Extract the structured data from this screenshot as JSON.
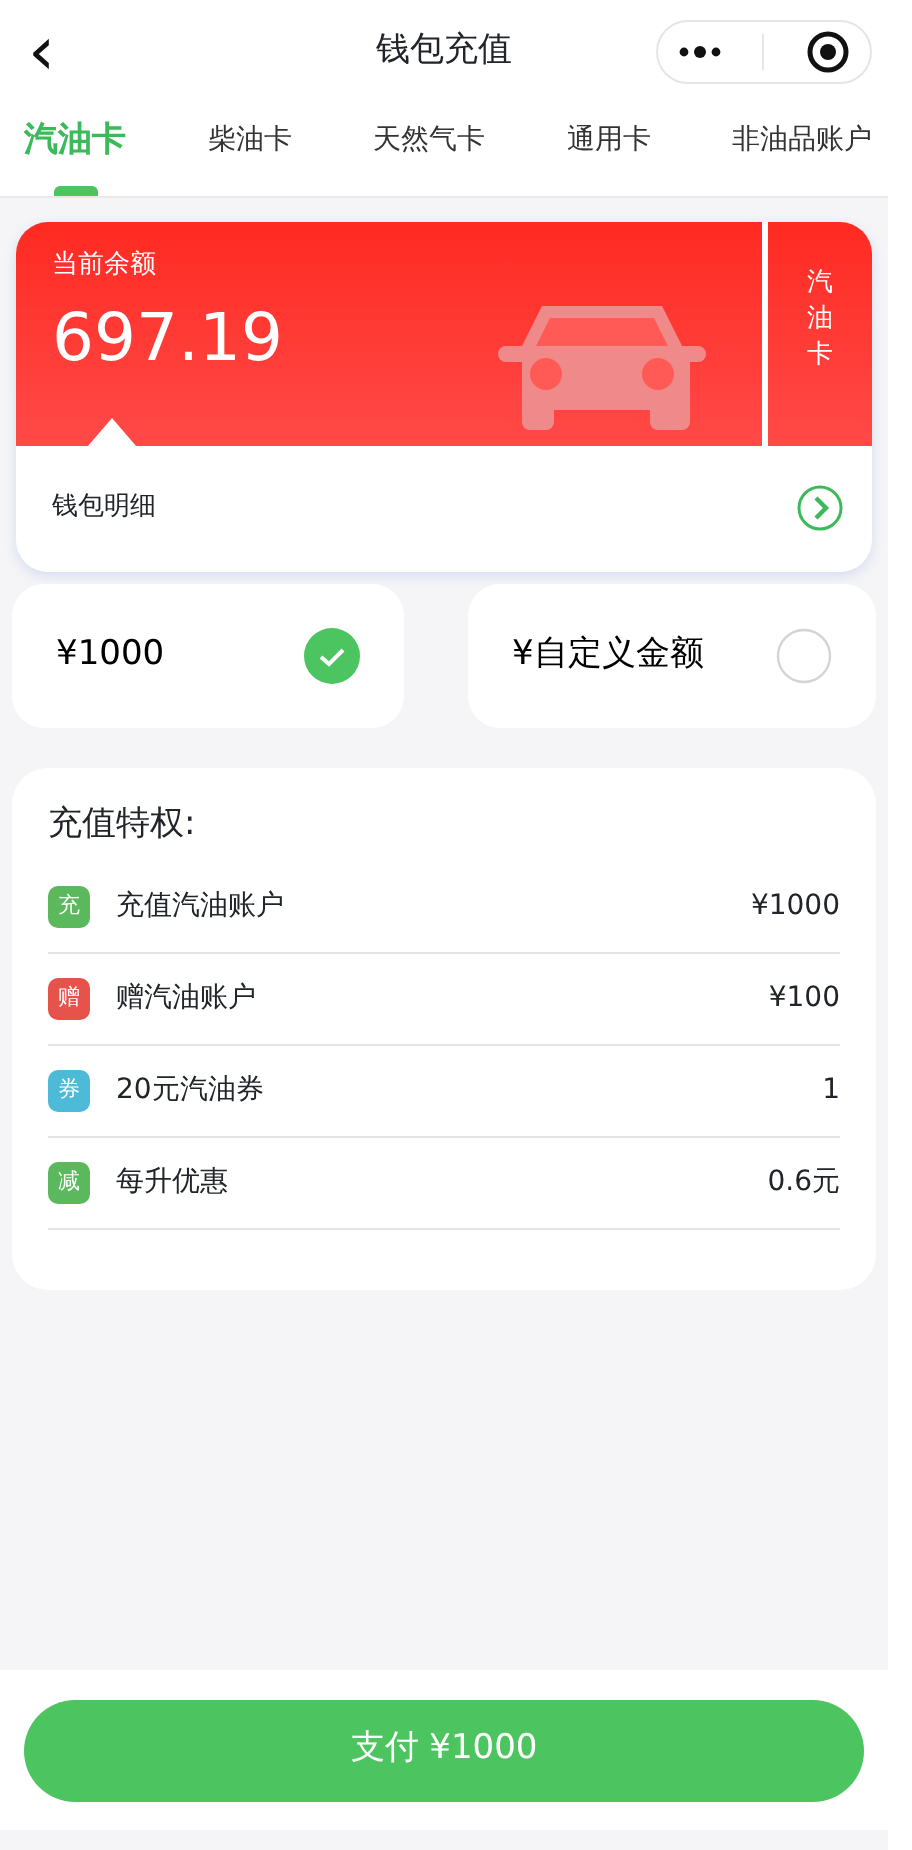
{
  "header": {
    "back": "‹",
    "title": "钱包充值"
  },
  "tabs": [
    {
      "label": "汽油卡",
      "selected": true
    },
    {
      "label": "柴油卡",
      "selected": false
    },
    {
      "label": "天然气卡",
      "selected": false
    },
    {
      "label": "通用卡",
      "selected": false
    },
    {
      "label": "非油品账户",
      "selected": false
    }
  ],
  "balance_card": {
    "label": "当前余额",
    "amount": "697.19",
    "side_label": "汽油卡",
    "detail_link": "钱包明细"
  },
  "amount_options": [
    {
      "label": "¥1000",
      "selected": true
    },
    {
      "label": "¥自定义金额",
      "selected": false
    }
  ],
  "privileges": {
    "title": "充值特权:",
    "items": [
      {
        "badge": "充",
        "label": "充值汽油账户",
        "value": "¥1000",
        "color": "#5cb85c"
      },
      {
        "badge": "赠",
        "label": "赠汽油账户",
        "value": "¥100",
        "color": "#e5534b"
      },
      {
        "badge": "券",
        "label": "20元汽油券",
        "value": "1",
        "color": "#4dbbd8"
      },
      {
        "badge": "减",
        "label": "每升优惠",
        "value": "0.6元",
        "color": "#5cb85c"
      }
    ]
  },
  "pay_button": "支付 ¥1000"
}
